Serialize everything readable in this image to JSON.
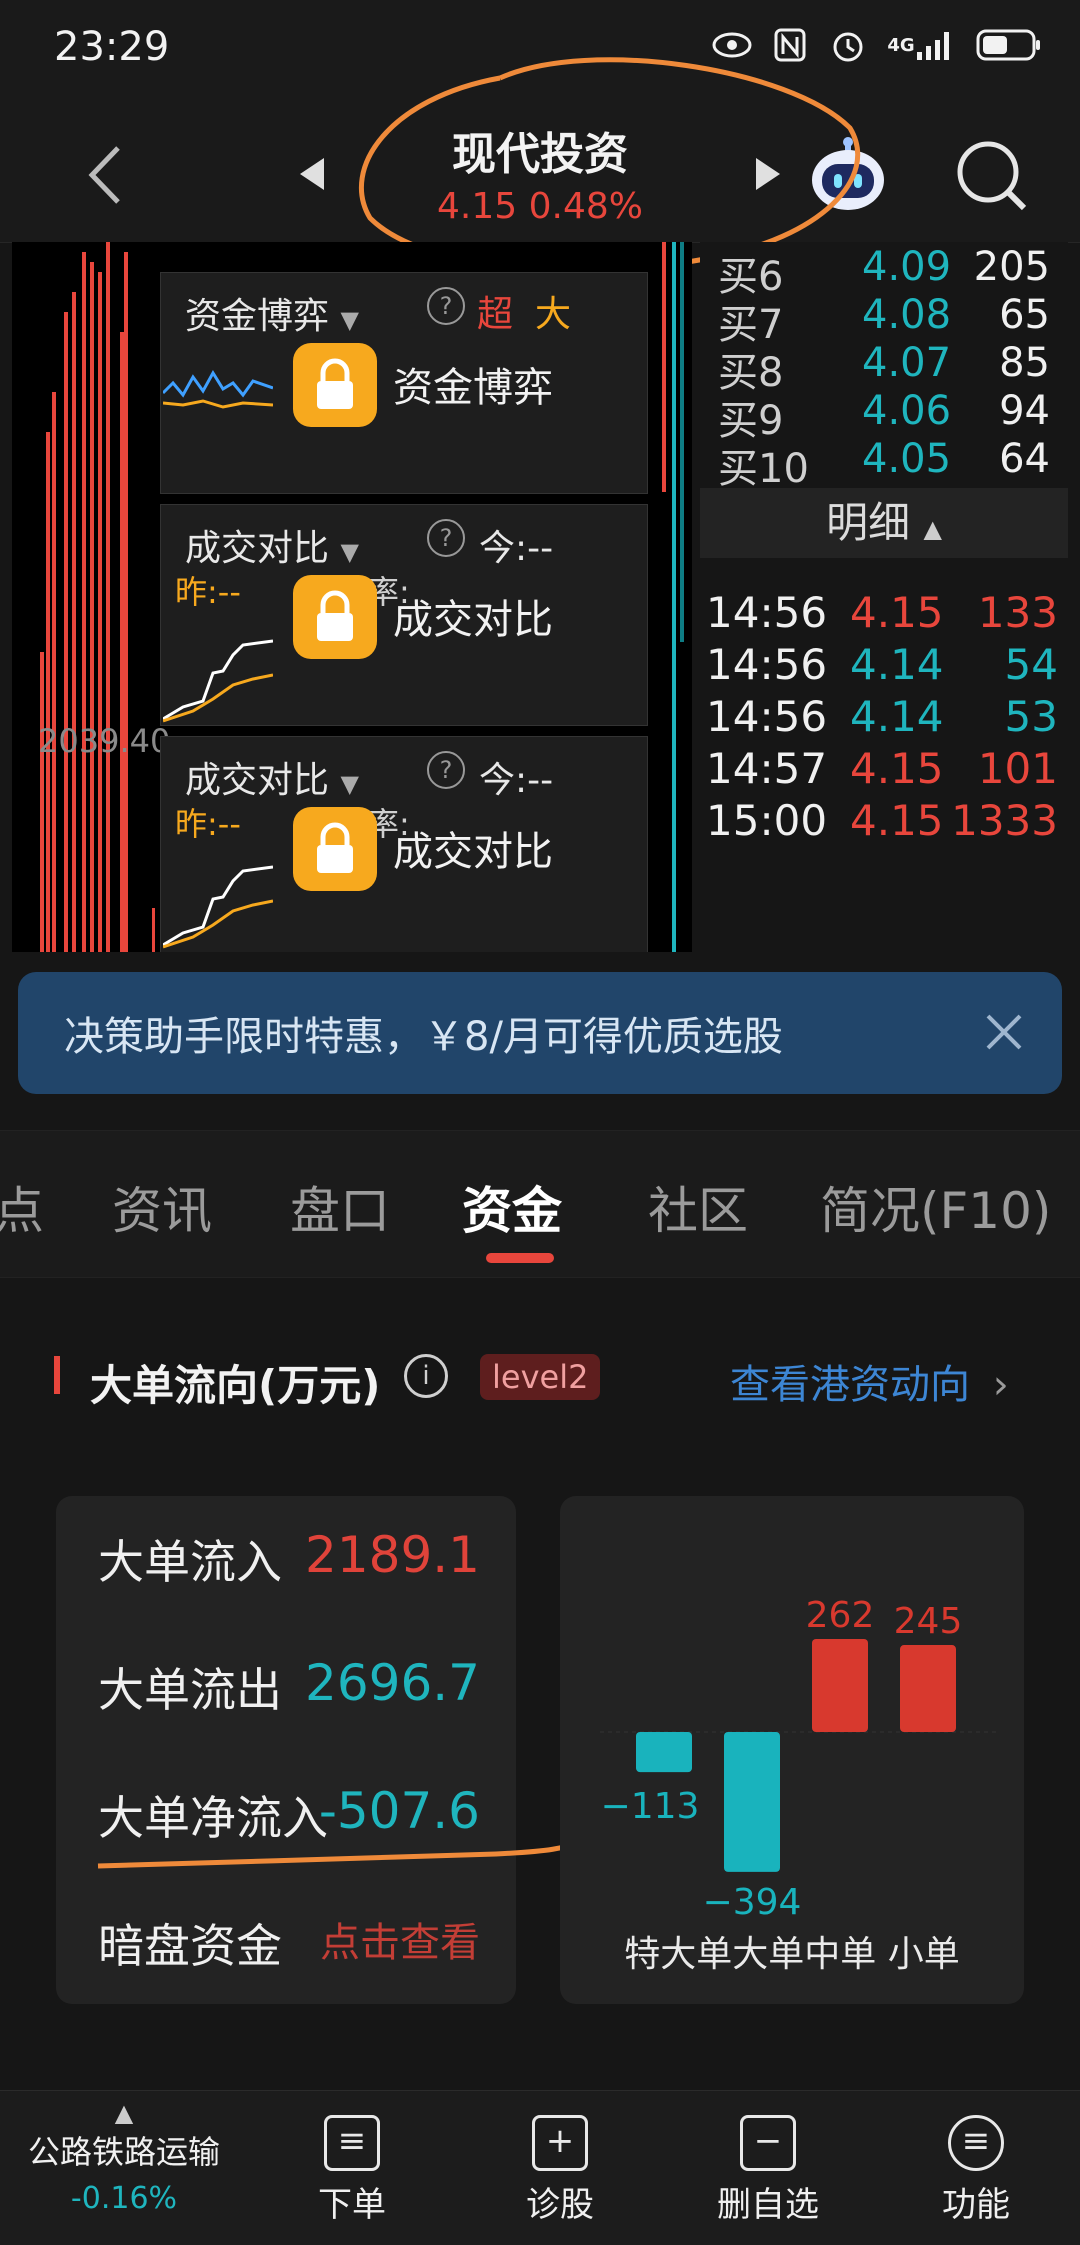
{
  "status_bar": {
    "time": "23:29",
    "network": "4G"
  },
  "header": {
    "stock_name": "现代投资",
    "price": "4.15",
    "change_pct": "0.48%"
  },
  "chart": {
    "price_label": "2039.40",
    "panels": [
      {
        "title": "资金博弈",
        "tag1": "超",
        "tag2": "大",
        "lock_label": "资金博弈"
      },
      {
        "title": "成交对比",
        "today": "今:--",
        "yesterday": "昨:--",
        "change": "变化率:",
        "lock_label": "成交对比"
      },
      {
        "title": "成交对比",
        "today": "今:--",
        "yesterday": "昨:--",
        "change": "变化率:",
        "lock_label": "成交对比"
      }
    ]
  },
  "order_book": {
    "buys": [
      {
        "label": "买6",
        "price": "4.09",
        "vol": "205"
      },
      {
        "label": "买7",
        "price": "4.08",
        "vol": "65"
      },
      {
        "label": "买8",
        "price": "4.07",
        "vol": "85"
      },
      {
        "label": "买9",
        "price": "4.06",
        "vol": "94"
      },
      {
        "label": "买10",
        "price": "4.05",
        "vol": "64"
      }
    ],
    "detail_title": "明细",
    "details": [
      {
        "time": "14:56",
        "price": "4.15",
        "vol": "133",
        "dir": "up"
      },
      {
        "time": "14:56",
        "price": "4.14",
        "vol": "54",
        "dir": "down"
      },
      {
        "time": "14:56",
        "price": "4.14",
        "vol": "53",
        "dir": "down"
      },
      {
        "time": "14:57",
        "price": "4.15",
        "vol": "101",
        "dir": "up"
      },
      {
        "time": "15:00",
        "price": "4.15",
        "vol": "1333",
        "dir": "up"
      }
    ]
  },
  "banner": {
    "text": "决策助手限时特惠，￥8/月可得优质选股"
  },
  "tabs": [
    "点",
    "资讯",
    "盘口",
    "资金",
    "社区",
    "简况(F10)"
  ],
  "active_tab": "资金",
  "money": {
    "section_title": "大单流向(万元)",
    "level_badge": "level2",
    "hk_link": "查看港资动向",
    "rows": [
      {
        "label": "大单流入",
        "value": "2189.1",
        "color": "#e0433a"
      },
      {
        "label": "大单流出",
        "value": "2696.7",
        "color": "#1fb5be"
      },
      {
        "label": "大单净流入",
        "value": "-507.6",
        "color": "#1fb5be"
      },
      {
        "label": "暗盘资金",
        "value": "点击查看",
        "color": "#e0433a"
      }
    ]
  },
  "chart_data": {
    "type": "bar",
    "categories": [
      "特大单",
      "大单",
      "中单",
      "小单"
    ],
    "values": [
      -113,
      -394,
      262,
      245
    ],
    "colors": {
      "positive": "#d8392e",
      "negative": "#19b3bd"
    }
  },
  "bottom_nav": [
    {
      "label": "公路铁路运输",
      "sub": "-0.16%",
      "icon": "sector-icon"
    },
    {
      "label": "下单",
      "icon": "order-icon",
      "glyph": "≡"
    },
    {
      "label": "诊股",
      "icon": "diagnose-icon",
      "glyph": "+"
    },
    {
      "label": "删自选",
      "icon": "remove-watchlist-icon",
      "glyph": "−"
    },
    {
      "label": "功能",
      "icon": "menu-icon",
      "glyph": "≡"
    }
  ]
}
